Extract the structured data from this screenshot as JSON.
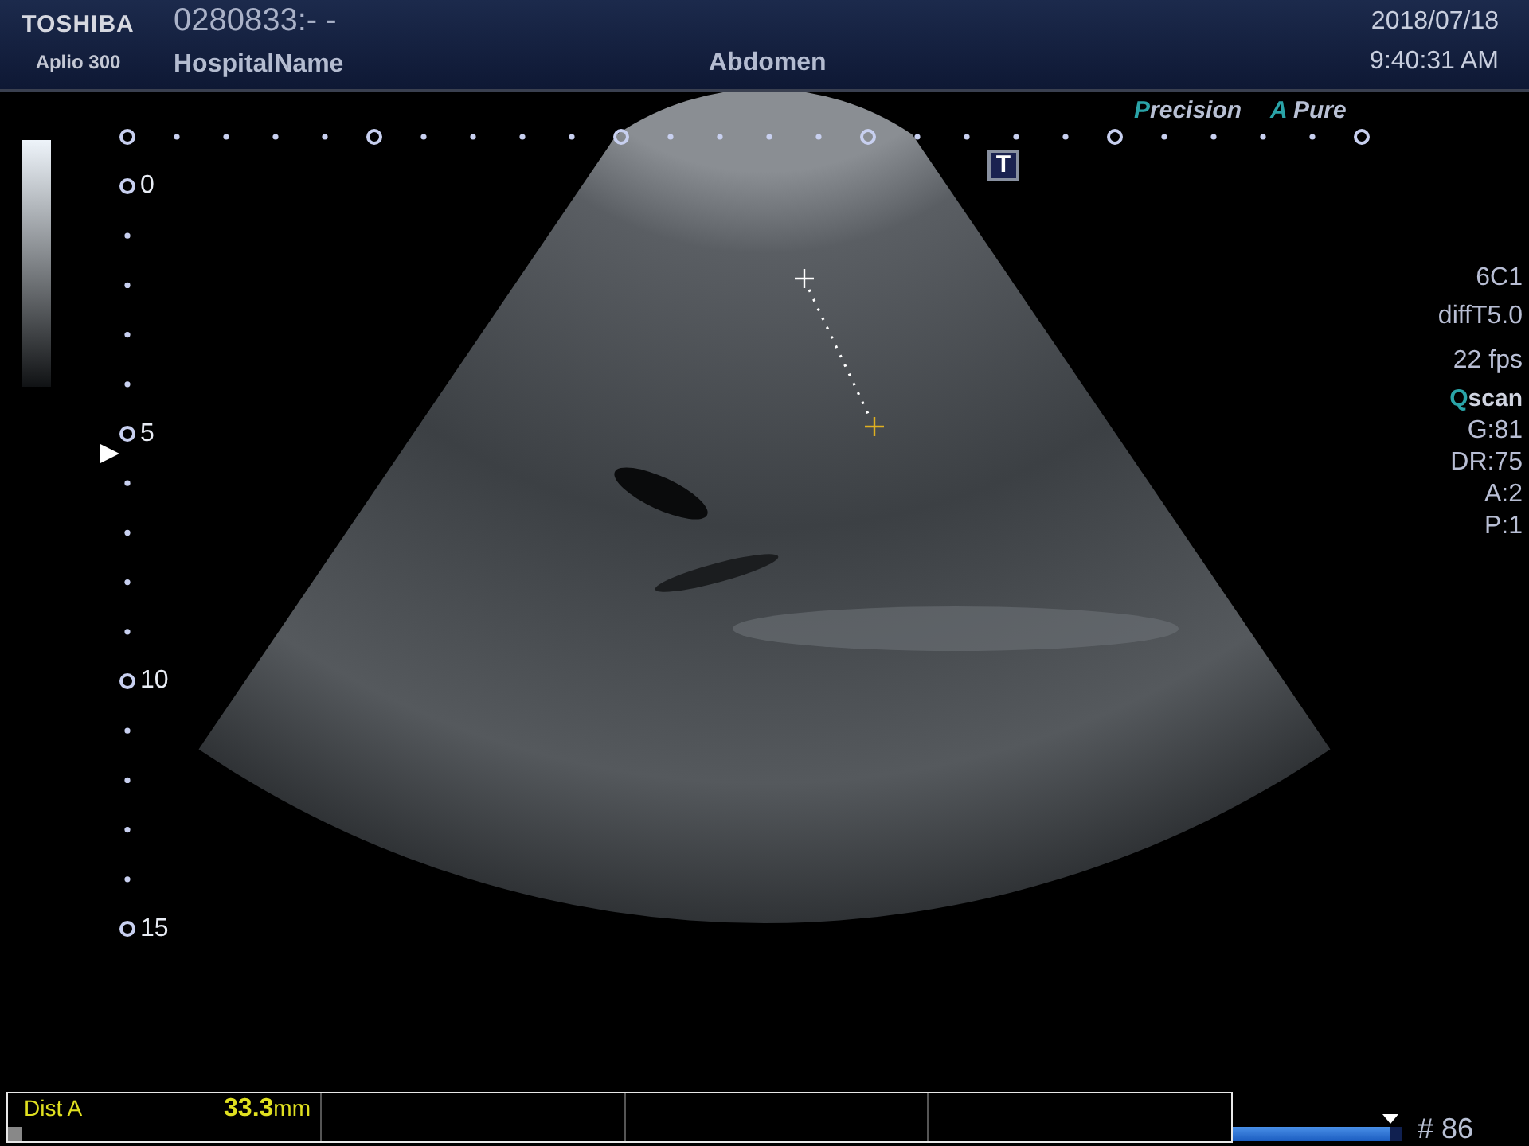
{
  "header": {
    "brand": "TOSHIBA",
    "model": "Aplio 300",
    "patient_id": "0280833:- -",
    "hospital": "HospitalName",
    "exam": "Abdomen",
    "date": "2018/07/18",
    "time": "9:40:31 AM"
  },
  "image_modes": [
    {
      "accent": "P",
      "rest": "recision"
    },
    {
      "accent": "A",
      "rest": " Pure"
    }
  ],
  "orientation_marker": "T",
  "depth_scale": {
    "labels": [
      "0",
      "5",
      "10",
      "15"
    ]
  },
  "parameters": [
    {
      "kind": "plain",
      "text": "6C1"
    },
    {
      "kind": "plain",
      "text": "diffT5.0"
    },
    {
      "kind": "gap",
      "text": "22 fps"
    },
    {
      "kind": "brand",
      "accent": "Q",
      "text": "scan"
    },
    {
      "kind": "plain",
      "text": "G:81"
    },
    {
      "kind": "plain",
      "text": "DR:75"
    },
    {
      "kind": "plain",
      "text": "A:2"
    },
    {
      "kind": "plain",
      "text": "P:1"
    }
  ],
  "measurement": {
    "label": "Dist A",
    "value": "33.3",
    "unit": "mm"
  },
  "cine": {
    "level": 0.93,
    "frame": "# 86"
  }
}
